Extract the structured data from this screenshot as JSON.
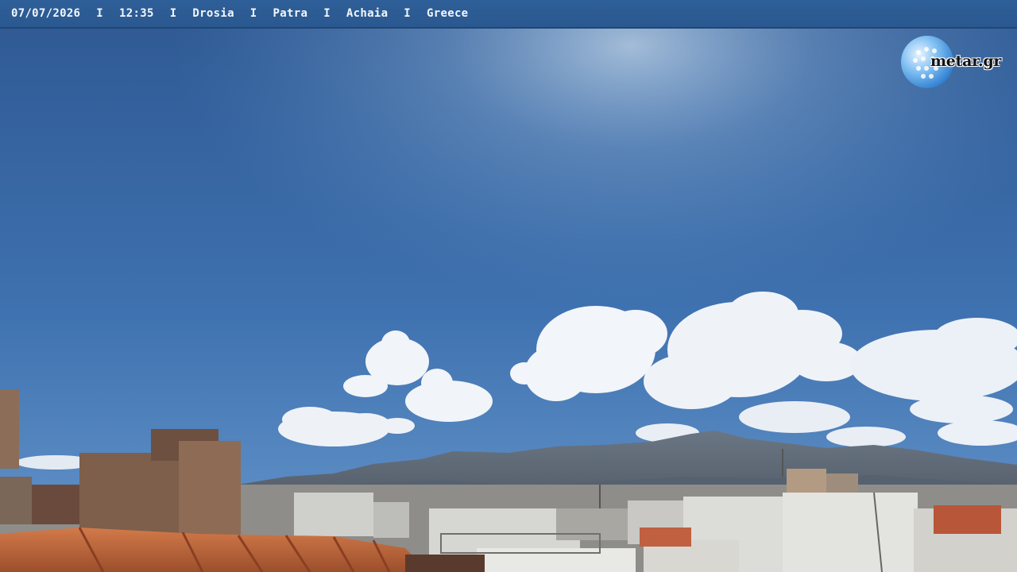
{
  "overlay": {
    "date": "07/07/2026",
    "time": "12:35",
    "area": "Drosia",
    "city": "Patra",
    "region": "Achaia",
    "country": "Greece",
    "separator": "I"
  },
  "brand": {
    "logo_text": "metar.gr"
  },
  "colors": {
    "sky_top": "#2e5892",
    "sky_bottom": "#5a8cc6",
    "mountain": "#5e6a7a",
    "roof": "#c2673a",
    "bar": "#2c5a94"
  }
}
